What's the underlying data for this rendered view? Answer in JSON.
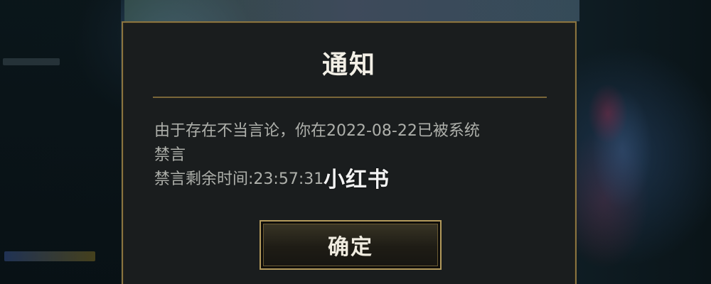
{
  "dialog": {
    "title": "通知",
    "message_line1": "由于存在不当言论，你在2022-08-22已被系统",
    "message_line2": "禁言",
    "countdown_label": "禁言剩余时间:",
    "countdown_value": "23:57:31",
    "confirm_label": "确定"
  },
  "watermark": {
    "text": "小红书"
  },
  "colors": {
    "dialog_border": "#8a7440",
    "dialog_bg": "#1a1d1e",
    "text_primary": "#f2efe6",
    "text_secondary": "#aeb0ab",
    "button_border": "#b39a5c"
  }
}
